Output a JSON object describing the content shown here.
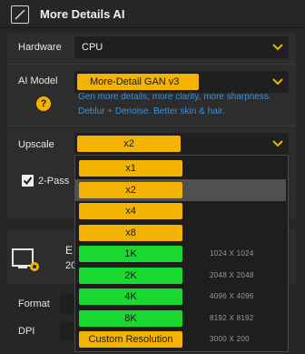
{
  "header": {
    "title": "More Details AI",
    "enabled": true
  },
  "hardware": {
    "label": "Hardware",
    "value": "CPU"
  },
  "ai_model": {
    "label": "AI Model",
    "value": "More-Detail GAN  v3",
    "help": "?",
    "description_line1": "Gen more details, more clarity, more sharpness.",
    "description_line2": "Deblur + Denoise. Better skin & hair."
  },
  "upscale": {
    "label": "Upscale",
    "value": "x2"
  },
  "two_pass": {
    "label": "2-Pass",
    "checked": true
  },
  "export": {
    "frag_title": "E",
    "frag_sub": "20",
    "format_label": "Format",
    "dpi_label": "DPI"
  },
  "upscale_options": [
    {
      "label": "x1",
      "resolution": "",
      "color": "#f3b300",
      "selected": false
    },
    {
      "label": "x2",
      "resolution": "",
      "color": "#f3b300",
      "selected": true
    },
    {
      "label": "x4",
      "resolution": "",
      "color": "#f3b300",
      "selected": false
    },
    {
      "label": "x8",
      "resolution": "",
      "color": "#f3b300",
      "selected": false
    },
    {
      "label": "1K",
      "resolution": "1024 X 1024",
      "color": "#19d830",
      "selected": false
    },
    {
      "label": "2K",
      "resolution": "2048 X 2048",
      "color": "#19d830",
      "selected": false
    },
    {
      "label": "4K",
      "resolution": "4096 X 4096",
      "color": "#19d830",
      "selected": false
    },
    {
      "label": "8K",
      "resolution": "8192 X 8192",
      "color": "#19d830",
      "selected": false
    },
    {
      "label": "Custom Resolution",
      "resolution": "3000 X 200",
      "color": "#f3b300",
      "selected": false
    }
  ],
  "colors": {
    "accent": "#f3b300",
    "green": "#19d830",
    "link": "#3f8fd6",
    "background": "#262626"
  }
}
